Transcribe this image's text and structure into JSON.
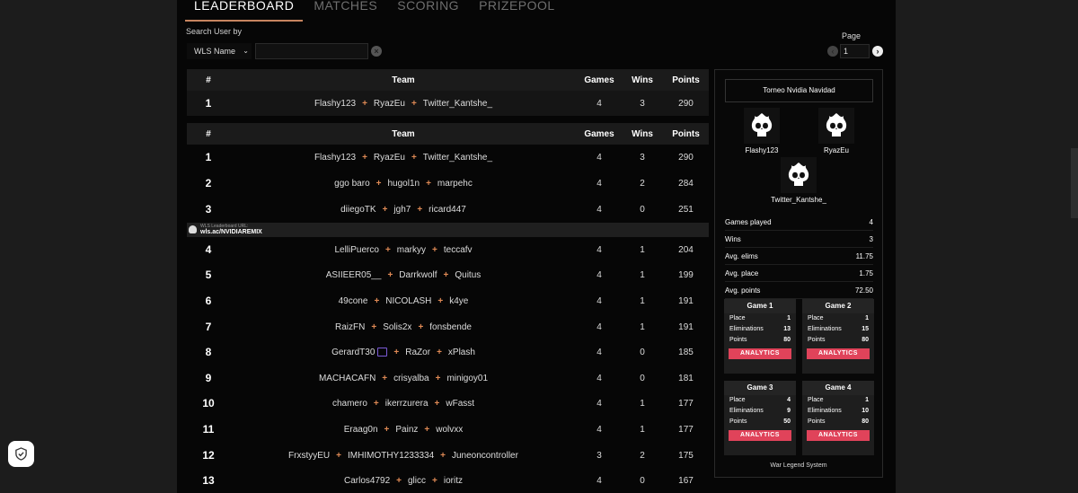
{
  "tabs": [
    "LEADERBOARD",
    "MATCHES",
    "SCORING",
    "PRIZEPOOL"
  ],
  "search": {
    "label": "Search User by",
    "select_value": "WLS Name",
    "input_value": "",
    "clear_icon": "close-icon"
  },
  "pagination": {
    "label": "Page",
    "value": "1"
  },
  "table_headers": {
    "rank": "#",
    "team": "Team",
    "games": "Games",
    "wins": "Wins",
    "points": "Points"
  },
  "pinned_row": {
    "rank": "1",
    "players": [
      "Flashy123",
      "RyazEu",
      "Twitter_Kantshe_"
    ],
    "games": "4",
    "wins": "3",
    "points": "290"
  },
  "rows": [
    {
      "rank": "1",
      "players": [
        "Flashy123",
        "RyazEu",
        "Twitter_Kantshe_"
      ],
      "games": "4",
      "wins": "3",
      "points": "290"
    },
    {
      "rank": "2",
      "players": [
        "ggo baro",
        "hugol1n",
        "marpehc"
      ],
      "games": "4",
      "wins": "2",
      "points": "284"
    },
    {
      "rank": "3",
      "players": [
        "diiegoTK",
        "jgh7",
        "ricard447"
      ],
      "games": "4",
      "wins": "0",
      "points": "251"
    },
    {
      "rank": "4",
      "players": [
        "LelliPuerco",
        "markyy",
        "teccafv"
      ],
      "games": "4",
      "wins": "1",
      "points": "204"
    },
    {
      "rank": "5",
      "players": [
        "ASIIEER05__",
        "Darrkwolf",
        "Quitus"
      ],
      "games": "4",
      "wins": "1",
      "points": "199"
    },
    {
      "rank": "6",
      "players": [
        "49cone",
        "NICOLASH",
        "k4ye"
      ],
      "games": "4",
      "wins": "1",
      "points": "191"
    },
    {
      "rank": "7",
      "players": [
        "RaizFN",
        "Solis2x",
        "fonsbende"
      ],
      "games": "4",
      "wins": "1",
      "points": "191"
    },
    {
      "rank": "8",
      "players": [
        "GerardT30",
        "RaZor",
        "xPlash"
      ],
      "games": "4",
      "wins": "0",
      "points": "185",
      "twitch_index": 0
    },
    {
      "rank": "9",
      "players": [
        "MACHACAFN",
        "crisyalba",
        "minigoy01"
      ],
      "games": "4",
      "wins": "0",
      "points": "181"
    },
    {
      "rank": "10",
      "players": [
        "chamero",
        "ikerrzurera",
        "wFasst"
      ],
      "games": "4",
      "wins": "1",
      "points": "177"
    },
    {
      "rank": "11",
      "players": [
        "Eraag0n",
        "Painz",
        "wolvxx"
      ],
      "games": "4",
      "wins": "1",
      "points": "177"
    },
    {
      "rank": "12",
      "players": [
        "FrxstyyEU",
        "IMHIMOTHY1233334",
        "Juneoncontroller"
      ],
      "games": "3",
      "wins": "2",
      "points": "175"
    },
    {
      "rank": "13",
      "players": [
        "Carlos4792",
        "glicc",
        "ioritz"
      ],
      "games": "4",
      "wins": "0",
      "points": "167"
    }
  ],
  "wls_bar": {
    "label": "WLS Leaderboard URL:",
    "url": "wls.ac/NVIDIAREMIX"
  },
  "side": {
    "title": "Torneo Nvidia Navidad",
    "players": [
      "Flashy123",
      "RyazEu",
      "Twitter_Kantshe_"
    ],
    "stats": [
      {
        "label": "Games played",
        "value": "4"
      },
      {
        "label": "Wins",
        "value": "3"
      },
      {
        "label": "Avg. elims",
        "value": "11.75"
      },
      {
        "label": "Avg. place",
        "value": "1.75"
      },
      {
        "label": "Avg. points",
        "value": "72.50"
      }
    ],
    "games": [
      {
        "title": "Game 1",
        "place": "1",
        "elims": "13",
        "points": "80"
      },
      {
        "title": "Game 2",
        "place": "1",
        "elims": "15",
        "points": "80"
      },
      {
        "title": "Game 3",
        "place": "4",
        "elims": "9",
        "points": "50"
      },
      {
        "title": "Game 4",
        "place": "1",
        "elims": "10",
        "points": "80"
      }
    ],
    "game_labels": {
      "place": "Place",
      "elims": "Eliminations",
      "points": "Points",
      "button": "ANALYTICS"
    },
    "footer": "War Legend System"
  },
  "colors": {
    "accent": "#e08a55",
    "analytics_button": "#e0435a",
    "twitch": "#7b5bd6"
  },
  "icons": [
    "close-icon",
    "chevron-down-icon",
    "chevron-left-icon",
    "chevron-right-icon",
    "skull-avatar-icon",
    "twitch-icon",
    "shield-check-icon",
    "wls-logo-icon"
  ]
}
